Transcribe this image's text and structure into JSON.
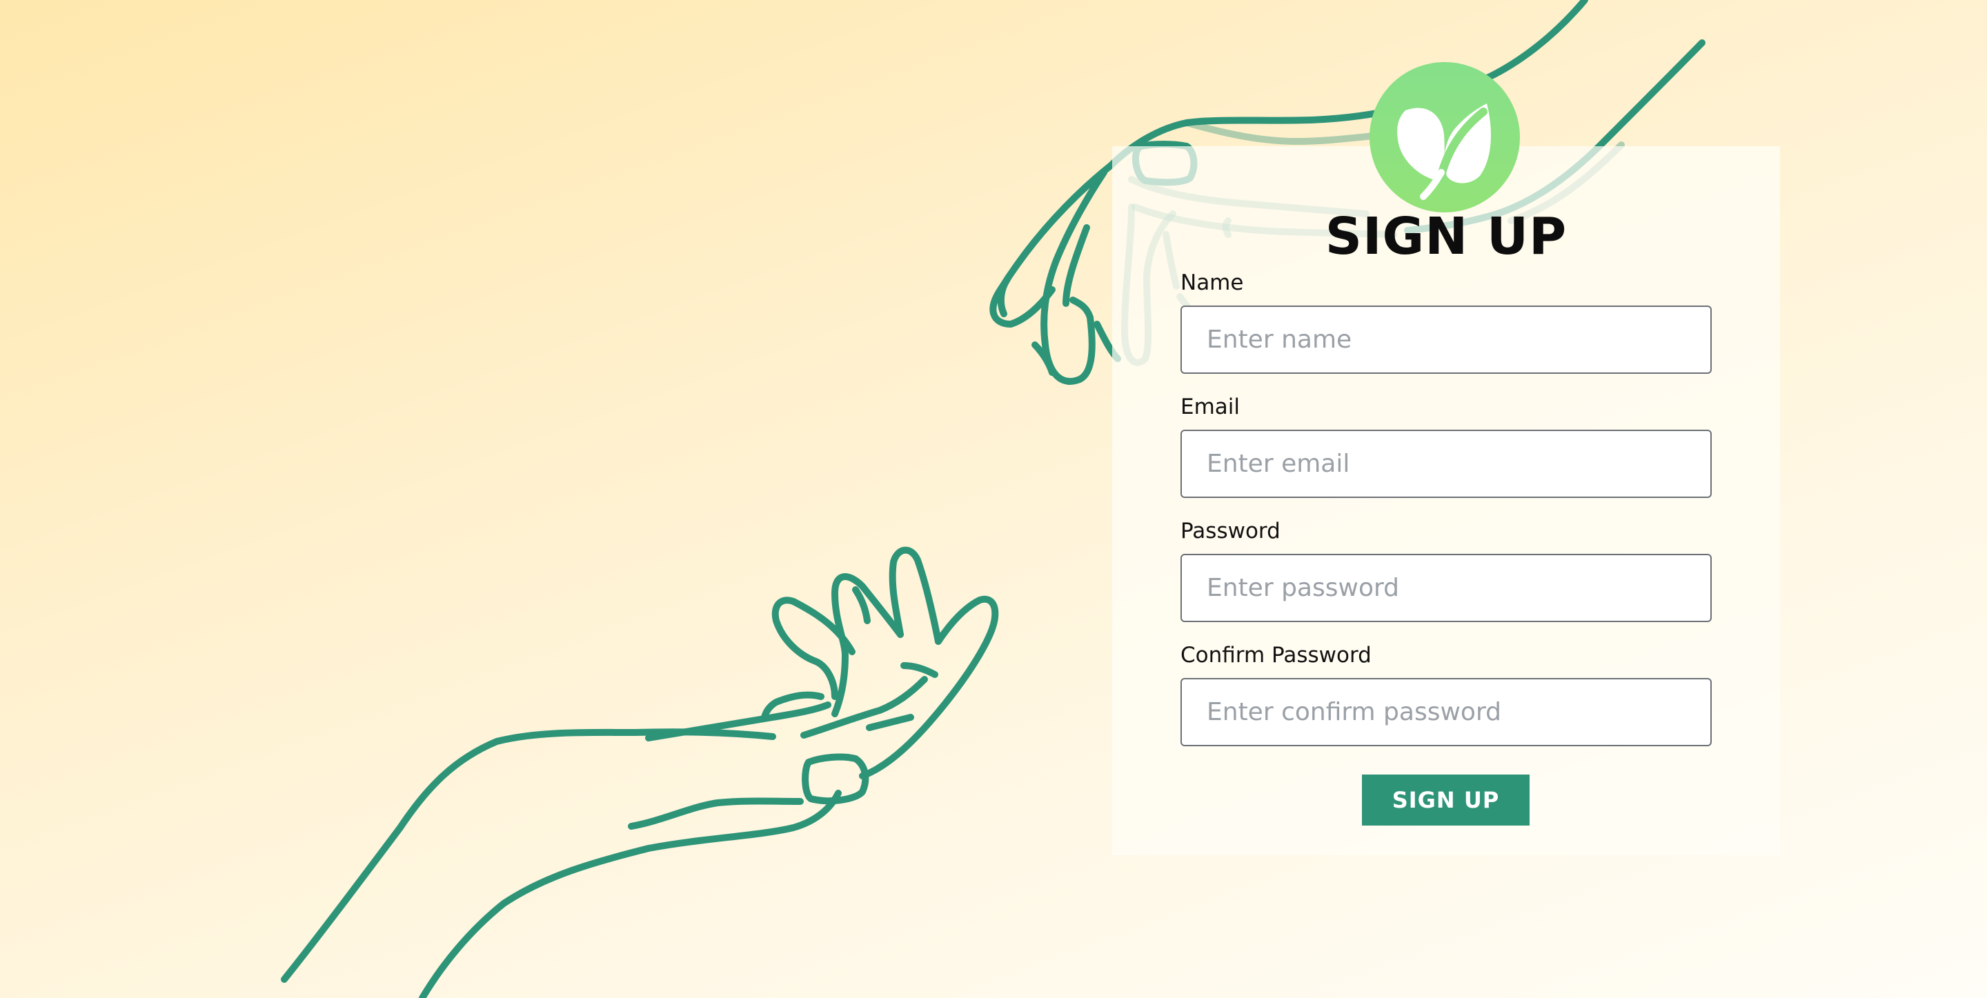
{
  "colors": {
    "accent": "#2e9478",
    "logo_green": "#8be07f",
    "background_top": "#ffe8ad",
    "background_bottom": "#fffdf7"
  },
  "icons": {
    "logo": "leaf-icon"
  },
  "form": {
    "title": "SIGN UP",
    "fields": [
      {
        "label": "Name",
        "placeholder": "Enter name",
        "type": "text"
      },
      {
        "label": "Email",
        "placeholder": "Enter email",
        "type": "email"
      },
      {
        "label": "Password",
        "placeholder": "Enter password",
        "type": "password"
      },
      {
        "label": "Confirm Password",
        "placeholder": "Enter confirm password",
        "type": "password"
      }
    ],
    "submit_label": "SIGN UP"
  }
}
